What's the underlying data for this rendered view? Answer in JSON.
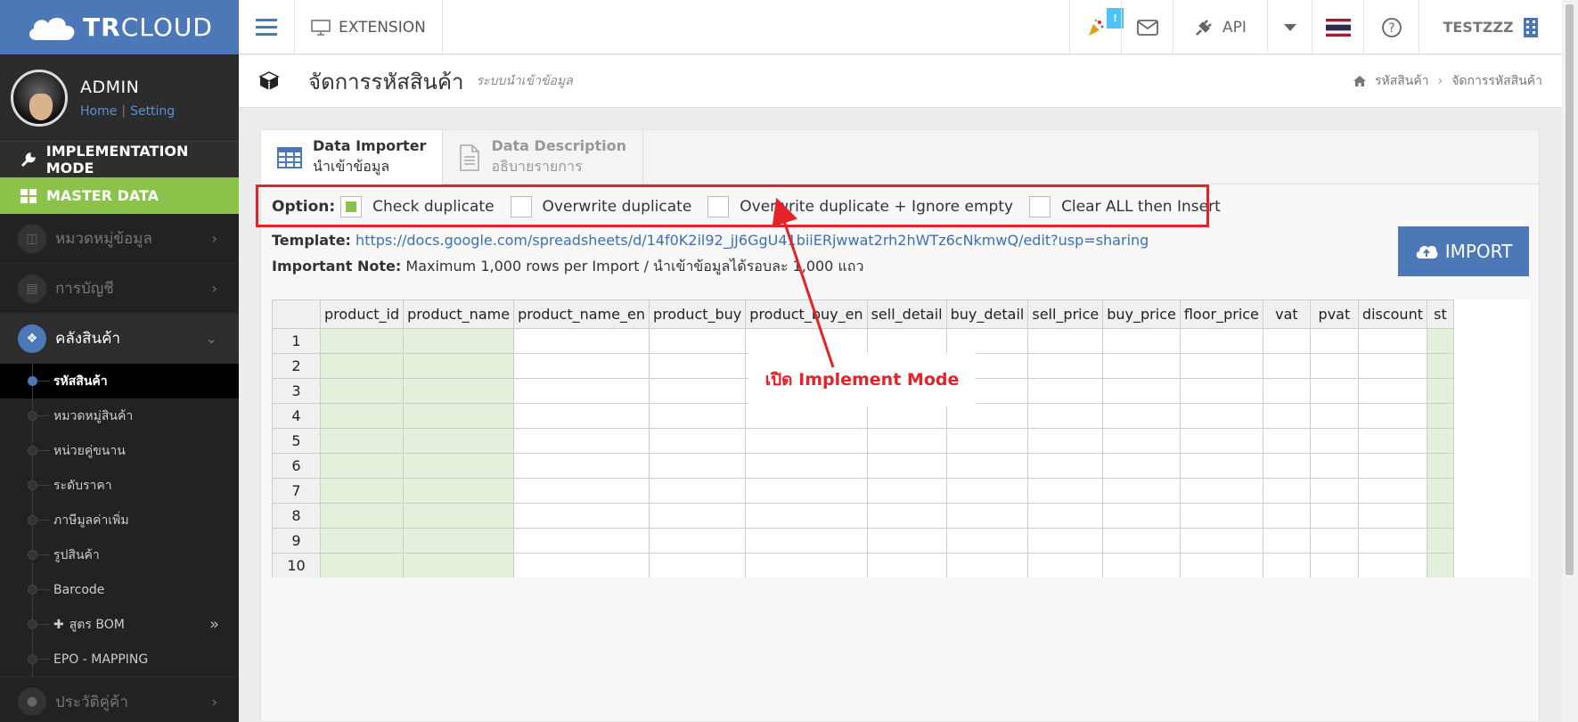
{
  "brand": {
    "name_bold": "TR",
    "name_light": "CLOUD"
  },
  "user": {
    "name": "ADMIN",
    "home": "Home",
    "separator": "|",
    "setting": "Setting"
  },
  "sidebar": {
    "implementation_mode": "IMPLEMENTATION MODE",
    "master_data": "MASTER DATA",
    "menu": [
      {
        "label": "หมวดหมู่ข้อมูล"
      },
      {
        "label": "การบัญชี"
      },
      {
        "label": "คลังสินค้า"
      },
      {
        "label": "ประวัติคู่ค้า"
      }
    ],
    "subitems": [
      {
        "label": "รหัสสินค้า"
      },
      {
        "label": "หมวดหมู่สินค้า"
      },
      {
        "label": "หน่วยคู่ขนาน"
      },
      {
        "label": "ระดับราคา"
      },
      {
        "label": "ภาษีมูลค่าเพิ่ม"
      },
      {
        "label": "รูปสินค้า"
      },
      {
        "label": "Barcode"
      },
      {
        "label": "สูตร BOM"
      },
      {
        "label": "EPO - MAPPING"
      }
    ]
  },
  "topbar": {
    "extension": "EXTENSION",
    "notification_badge": "!",
    "api": "API",
    "user": "TESTZZZ"
  },
  "page": {
    "title": "จัดการรหัสสินค้า",
    "subtitle": "ระบบนำเข้าข้อมูล",
    "breadcrumb": [
      "รหัสสินค้า",
      "จัดการรหัสสินค้า"
    ]
  },
  "tabs": [
    {
      "title": "Data Importer",
      "subtitle": "นำเข้าข้อมูล"
    },
    {
      "title": "Data Description",
      "subtitle": "อธิบายรายการ"
    }
  ],
  "options": {
    "label": "Option:",
    "items": [
      {
        "label": "Check duplicate",
        "checked": true
      },
      {
        "label": "Overwrite duplicate",
        "checked": false
      },
      {
        "label": "Overwrite duplicate + Ignore empty",
        "checked": false
      },
      {
        "label": "Clear ALL then Insert",
        "checked": false
      }
    ]
  },
  "template": {
    "label": "Template:",
    "url": "https://docs.google.com/spreadsheets/d/14f0K2il92_jJ6GgU41biiERjwwat2rh2hWTz6cNkmwQ/edit?usp=sharing"
  },
  "note": {
    "label": "Important Note:",
    "text": "Maximum 1,000 rows per Import / นำเข้าข้อมูลได้รอบละ 1,000 แถว"
  },
  "import_button": "IMPORT",
  "grid": {
    "columns": [
      "product_id",
      "product_name",
      "product_name_en",
      "product_buy",
      "product_buy_en",
      "sell_detail",
      "buy_detail",
      "sell_price",
      "buy_price",
      "floor_price",
      "vat",
      "pvat",
      "discount",
      "st"
    ],
    "rows": [
      "1",
      "2",
      "3",
      "4",
      "5",
      "6",
      "7",
      "8",
      "9",
      "10"
    ]
  },
  "annotation": "เปิด Implement Mode",
  "colors": {
    "brand": "#4d78b8",
    "master_data": "#8bc34a",
    "annotation": "#e5222a"
  }
}
